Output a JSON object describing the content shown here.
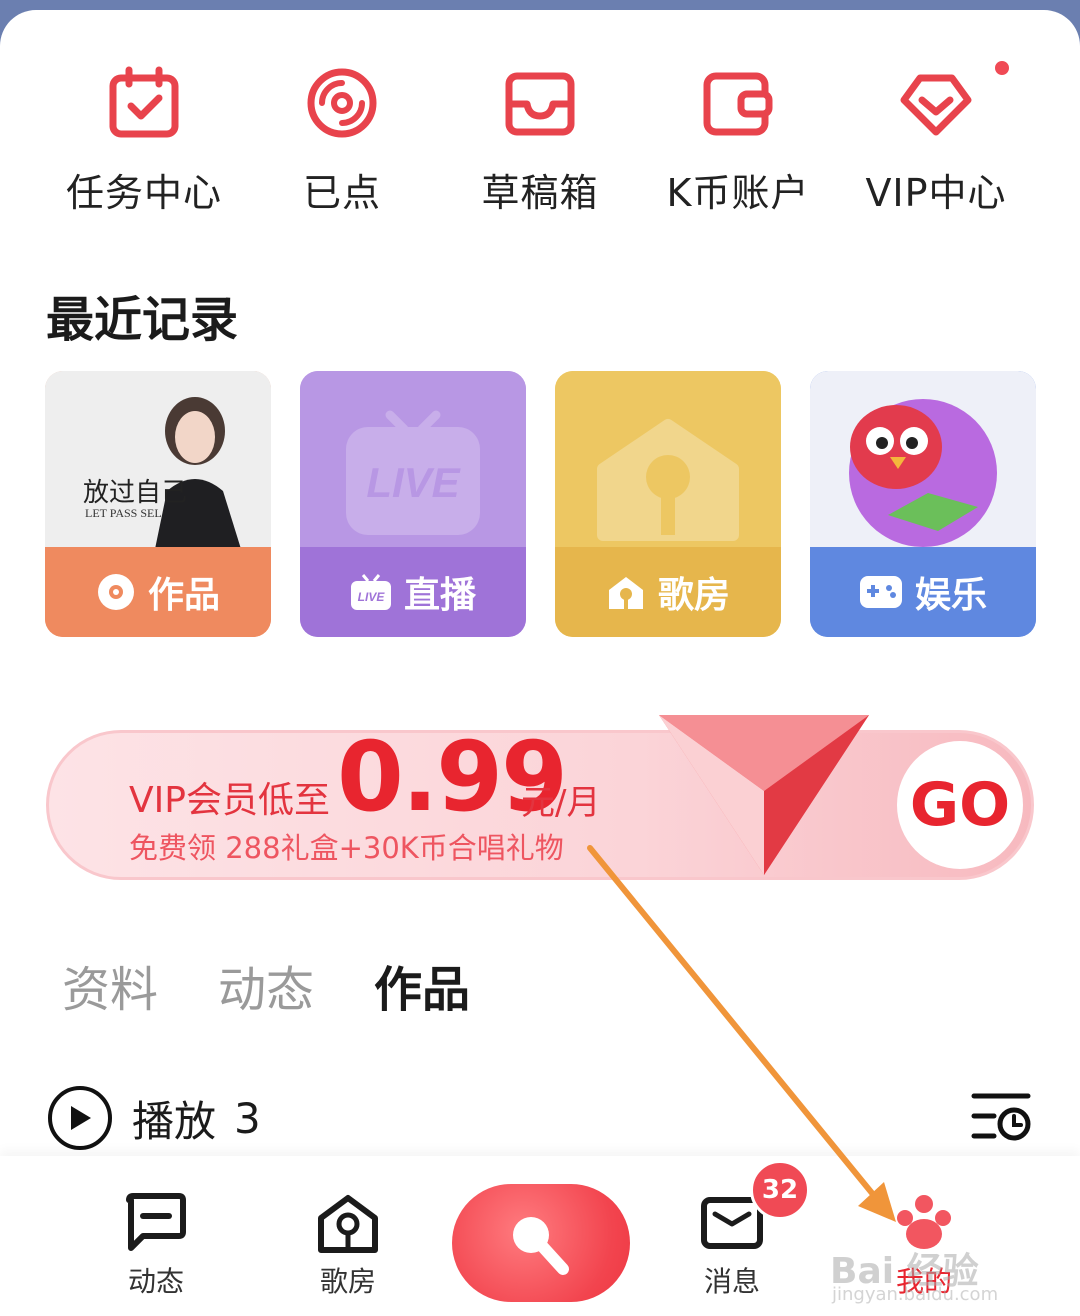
{
  "quick_actions": [
    {
      "label": "任务中心",
      "icon": "calendar-check-icon"
    },
    {
      "label": "已点",
      "icon": "disc-icon"
    },
    {
      "label": "草稿箱",
      "icon": "inbox-tray-icon"
    },
    {
      "label": "K币账户",
      "icon": "wallet-icon"
    },
    {
      "label": "VIP中心",
      "icon": "vip-diamond-icon"
    }
  ],
  "recent": {
    "title": "最近记录",
    "cards": [
      {
        "label": "作品",
        "icon": "disc-icon",
        "color": "#ef8a5f"
      },
      {
        "label": "直播",
        "icon": "live-tv-icon",
        "color": "#9f73d8"
      },
      {
        "label": "歌房",
        "icon": "house-icon",
        "color": "#e6b64c"
      },
      {
        "label": "娱乐",
        "icon": "gamepad-icon",
        "color": "#5f88e0"
      }
    ],
    "live_art_text": "LIVE",
    "album_text": "放过自己",
    "album_sub": "LET PASS SEL"
  },
  "vip_banner": {
    "line1": "VIP会员低至",
    "price": "0.99",
    "unit": "元/月",
    "line2": "免费领 288礼盒+30K币合唱礼物",
    "go": "GO"
  },
  "profile_tabs": [
    {
      "label": "资料",
      "active": false
    },
    {
      "label": "动态",
      "active": false
    },
    {
      "label": "作品",
      "active": true
    }
  ],
  "play_row": {
    "label": "播放",
    "count": "3"
  },
  "bottom_nav": {
    "items": [
      {
        "label": "动态",
        "icon": "chat-bubble-icon"
      },
      {
        "label": "歌房",
        "icon": "house-icon"
      },
      {
        "label": "消息",
        "icon": "envelope-icon"
      },
      {
        "label": "我的",
        "icon": "paw-icon"
      }
    ],
    "message_badge": "32"
  },
  "watermark": {
    "text": "Bai 经验",
    "sub": "jingyan.baidu.com"
  },
  "colors": {
    "accent": "#e8252f",
    "annotation_arrow": "#f0953a"
  }
}
